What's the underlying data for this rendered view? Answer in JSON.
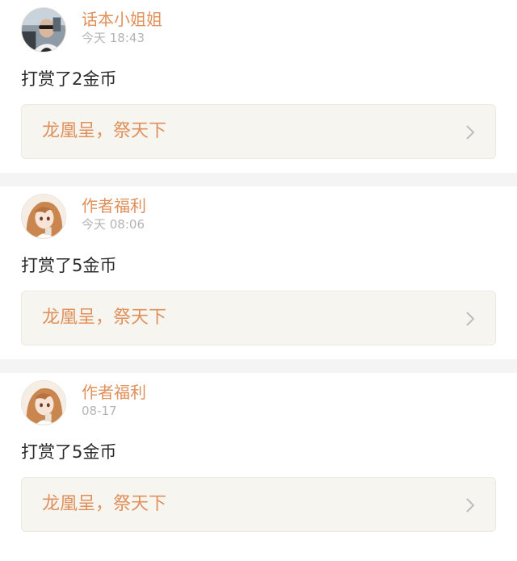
{
  "feed": [
    {
      "user": "话本小姐姐",
      "avatar_icon": "profile-photo-man-sunglasses",
      "time": "今天 18:43",
      "message": "打赏了2金币",
      "book_title": "龙凰呈，祭天下"
    },
    {
      "user": "作者福利",
      "avatar_icon": "profile-photo-anime-girl",
      "time": "今天 08:06",
      "message": "打赏了5金币",
      "book_title": "龙凰呈，祭天下"
    },
    {
      "user": "作者福利",
      "avatar_icon": "profile-photo-anime-girl",
      "time": "08-17",
      "message": "打赏了5金币",
      "book_title": "龙凰呈，祭天下"
    }
  ],
  "colors": {
    "accent": "#e0905a",
    "timestamp": "#b4b4b4",
    "card_bg": "#f6f5f0",
    "divider": "#f4f4f4"
  }
}
